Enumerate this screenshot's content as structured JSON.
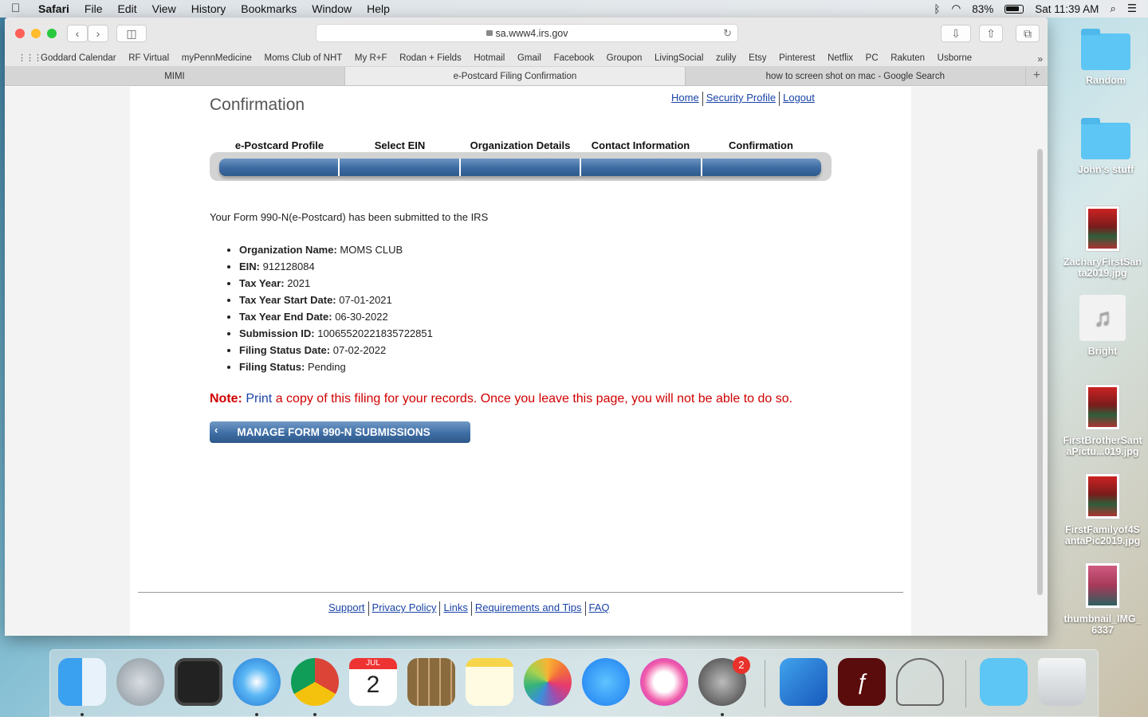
{
  "menubar": {
    "app": "Safari",
    "items": [
      "File",
      "Edit",
      "View",
      "History",
      "Bookmarks",
      "Window",
      "Help"
    ],
    "battery": "83%",
    "clock": "Sat 11:39 AM"
  },
  "browser": {
    "url": "sa.www4.irs.gov",
    "bookmarks": [
      "Goddard Calendar",
      "RF Virtual",
      "myPennMedicine",
      "Moms Club of NHT",
      "My R+F",
      "Rodan + Fields",
      "Hotmail",
      "Gmail",
      "Facebook",
      "Groupon",
      "LivingSocial",
      "zulily",
      "Etsy",
      "Pinterest",
      "Netflix",
      "PC",
      "Rakuten",
      "Usborne"
    ],
    "tabs": [
      "MIMI",
      "e-Postcard Filing Confirmation",
      "how to screen shot on mac - Google Search"
    ]
  },
  "page": {
    "title": "Confirmation",
    "top_links": [
      "Home",
      "Security Profile",
      "Logout"
    ],
    "steps": [
      "e-Postcard Profile",
      "Select EIN",
      "Organization Details",
      "Contact Information",
      "Confirmation"
    ],
    "intro": "Your Form 990-N(e-Postcard) has been submitted to the IRS",
    "details": [
      {
        "label": "Organization Name:",
        "value": "MOMS CLUB"
      },
      {
        "label": "EIN:",
        "value": "912128084"
      },
      {
        "label": "Tax Year:",
        "value": "2021"
      },
      {
        "label": "Tax Year Start Date:",
        "value": "07-01-2021"
      },
      {
        "label": "Tax Year End Date:",
        "value": "06-30-2022"
      },
      {
        "label": "Submission ID:",
        "value": "10065520221835722851"
      },
      {
        "label": "Filing Status Date:",
        "value": "07-02-2022"
      },
      {
        "label": "Filing Status:",
        "value": "Pending"
      }
    ],
    "note_label": "Note:",
    "note_link": "Print",
    "note_text": "a copy of this filing for your records. Once you leave this page, you will not be able to do so.",
    "manage_button": "MANAGE FORM 990-N SUBMISSIONS",
    "footer_links": [
      "Support",
      "Privacy Policy",
      "Links",
      "Requirements and Tips",
      "FAQ"
    ]
  },
  "desktop": {
    "items": [
      "Random",
      "John's stuff",
      "ZacharyFirstSanta2019.jpg",
      "Bright",
      "FirstBrotherSantaPictu...019.jpg",
      "FirstFamilyof4SantaPic2019.jpg",
      "thumbnail_IMG_6337"
    ]
  },
  "dock": {
    "calendar_month": "JUL",
    "calendar_day": "2",
    "settings_badge": "2"
  },
  "colors": {
    "link": "#1a44a8",
    "note_red": "#d00000",
    "step_blue": "#3c6aa0"
  }
}
